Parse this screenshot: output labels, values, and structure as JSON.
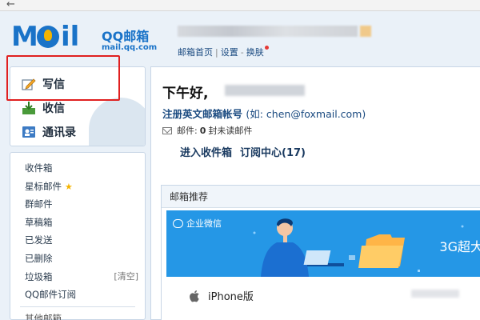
{
  "header": {
    "logo_text": "MOil",
    "logo_cn": "QQ邮箱",
    "logo_url": "mail.qq.com",
    "links": [
      "邮箱首页",
      "设置",
      "换肤"
    ]
  },
  "sidebar": {
    "write": "写信",
    "inbox": "收信",
    "contacts": "通讯录",
    "folders": [
      "收件箱",
      "星标邮件",
      "群邮件",
      "草稿箱",
      "已发送",
      "已删除",
      "垃圾箱",
      "QQ邮件订阅"
    ],
    "clear": "[清空]",
    "other": "其他邮箱"
  },
  "main": {
    "greeting": "下午好,",
    "register": "注册英文邮箱帐号",
    "register_hint": "(如: chen@foxmail.com)",
    "mail_label": "邮件:",
    "unread_count": "0",
    "unread_suffix": "封未读邮件",
    "inbox_link": "进入收件箱",
    "subscribe_link": "订阅中心(17)",
    "recommend_title": "邮箱推荐",
    "banner_brand": "企业微信",
    "banner_text": "3G超大",
    "iphone": "iPhone版"
  }
}
